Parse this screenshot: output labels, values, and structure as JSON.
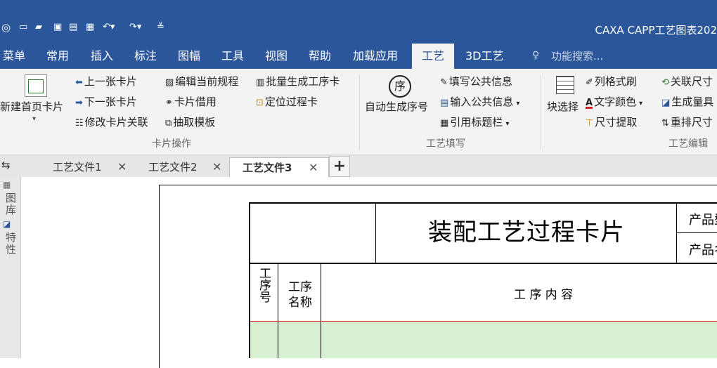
{
  "app_title": "CAXA CAPP工艺图表202",
  "quick_access": [
    "app-logo-icon",
    "new-file-icon",
    "open-folder-icon",
    "save-icon",
    "save-all-icon",
    "print-icon",
    "undo-icon",
    "redo-icon",
    "customize-icon"
  ],
  "ribbon_tabs": [
    "菜单",
    "常用",
    "插入",
    "标注",
    "图幅",
    "工具",
    "视图",
    "帮助",
    "加载应用",
    "工艺",
    "3D工艺"
  ],
  "search_placeholder": "功能搜索...",
  "ribbon": {
    "card_ops": {
      "new_first": "新建首页卡片",
      "prev": "上一张卡片",
      "next": "下一张卡片",
      "modify_link": "修改卡片关联",
      "edit_rule": "编辑当前规程",
      "borrow": "卡片借用",
      "extract_template": "抽取模板",
      "batch": "批量生成工序卡",
      "locate": "定位过程卡",
      "group_label": "卡片操作"
    },
    "craft_fill": {
      "auto_seq": "自动生成序号",
      "seq_glyph": "序",
      "fill_public": "填写公共信息",
      "input_public": "输入公共信息",
      "ref_title": "引用标题栏",
      "group_label": "工艺填写"
    },
    "craft_edit": {
      "block_select": "块选择",
      "col_brush": "列格式刷",
      "text_color": "文字颜色",
      "dim_extract": "尺寸提取",
      "link_dim": "关联尺寸",
      "gen_amount": "生成量具",
      "rearrange": "重排尺寸",
      "group_label": "工艺编辑"
    }
  },
  "doc_tabs": [
    "工艺文件1",
    "工艺文件2",
    "工艺文件3"
  ],
  "active_doc_tab": 2,
  "side_panel": [
    "图库",
    "特性"
  ],
  "card": {
    "title": "装配工艺过程卡片",
    "product_model": "产品型",
    "product_name": "产品名",
    "col_seq": "工序号",
    "col_name_1": "工序",
    "col_name_2": "名称",
    "col_content": "工 序 内 容"
  },
  "colors": {
    "titlebar": "#2b579a",
    "ribbon": "#f3f3f3",
    "highlight_row": "#d7f0d2",
    "red_line": "#e03030"
  }
}
